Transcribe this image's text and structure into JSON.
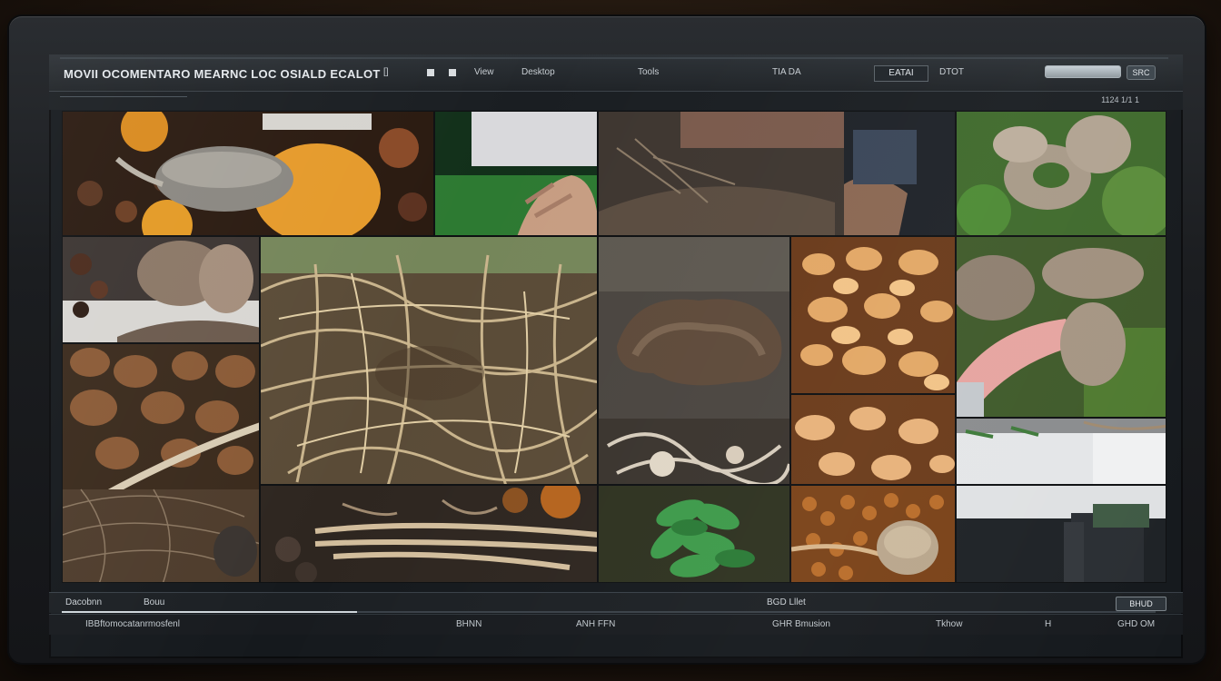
{
  "window": {
    "title": "MOVII OCOMENTARO MEARNC LOC OSIALD ECALOT",
    "toolbar": [
      "[]",
      "View",
      "Desktop"
    ],
    "menu_right": [
      "Tools",
      "TIA DA",
      "EATAI",
      "DTOT"
    ],
    "zoom": "EATAI",
    "search_placeholder": "",
    "search_button": "SRC",
    "item_count": "1124  1/1 1"
  },
  "gallery": {
    "tiles": [
      {
        "name": "tile-mushroom-oranges",
        "label": "mushroom with oranges"
      },
      {
        "name": "tile-green-hand",
        "label": "hand on green"
      },
      {
        "name": "tile-soil-hand",
        "label": "soil and roots"
      },
      {
        "name": "tile-moss-mushrooms",
        "label": "mushrooms on moss"
      },
      {
        "name": "tile-beans-cap",
        "label": "beans and cap"
      },
      {
        "name": "tile-mycelium-roots",
        "label": "mycelium roots"
      },
      {
        "name": "tile-brown-fungus",
        "label": "brown fungus"
      },
      {
        "name": "tile-golden-mushrooms-1",
        "label": "golden mushrooms"
      },
      {
        "name": "tile-pink-hand-cap",
        "label": "hand holding cap"
      },
      {
        "name": "tile-brown-pebbles",
        "label": "brown pebbles"
      },
      {
        "name": "tile-golden-mushrooms-2",
        "label": "golden mushrooms"
      },
      {
        "name": "tile-white-surface",
        "label": "white surface"
      },
      {
        "name": "tile-root-bundle",
        "label": "root bundle"
      },
      {
        "name": "tile-green-leaves",
        "label": "green leaves"
      },
      {
        "name": "tile-orange-cap",
        "label": "orange cap cluster"
      },
      {
        "name": "tile-dark-object",
        "label": "dark object"
      }
    ]
  },
  "footer": {
    "left_1": "Dacobnn",
    "left_2": "Bouu",
    "center": "BGD Lllet",
    "page_button": "BHUD",
    "status_left": "IBBftomocatanrmosfenl",
    "status_items": [
      "BHNN",
      "ANH FFN",
      "GHR Bmusion",
      "Tkhow",
      "H",
      "GHD OM"
    ],
    "progress": 0.27
  },
  "colors": {
    "screen_bg": "#15191d",
    "titlebar": "#2c3136",
    "accent": "#cfd6db"
  }
}
